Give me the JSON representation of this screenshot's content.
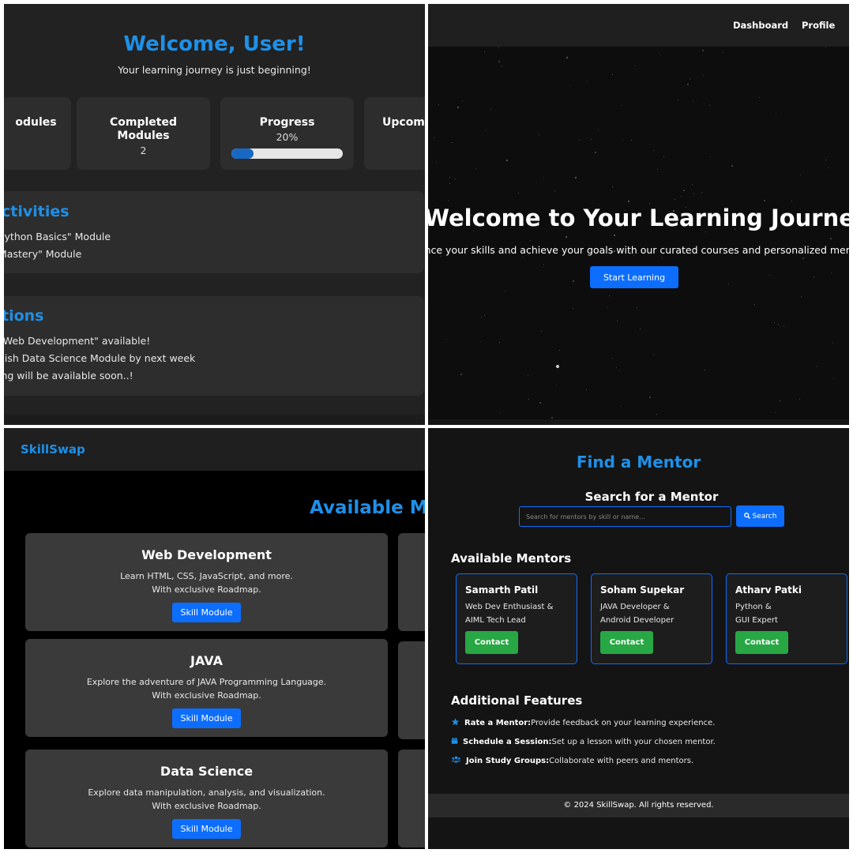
{
  "dashboard": {
    "title": "Welcome, User!",
    "subtitle": "Your learning journey is just beginning!",
    "stats": [
      {
        "label": "odules",
        "value": ""
      },
      {
        "label": "Completed Modules",
        "value": "2"
      },
      {
        "label": "Progress",
        "value": "20%",
        "progress_fraction": 0.2
      },
      {
        "label": "Upcomi",
        "value": ""
      }
    ],
    "activities": {
      "title": "ctivities",
      "items": [
        "Python Basics\" Module",
        " Mastery\" Module"
      ]
    },
    "notifications": {
      "title": "tions",
      "items": [
        "\"Web Development\" available!",
        "nish Data Science Module by next week",
        "ing will be available soon..!"
      ]
    }
  },
  "hero": {
    "nav": [
      "Dashboard",
      "Profile"
    ],
    "title": "Welcome to Your Learning Journey",
    "subtitle": "nhance your skills and achieve your goals with our curated courses and personalized mentors",
    "cta": "Start Learning"
  },
  "modules": {
    "brand": "SkillSwap",
    "title": "Available Mo",
    "button_label": "Skill Module",
    "cards": [
      {
        "title": "Web Development",
        "desc1": "Learn HTML, CSS, JavaScript, and more.",
        "desc2": "With exclusive Roadmap."
      },
      {
        "title": "JAVA",
        "desc1": "Explore the adventure of JAVA Programming Language.",
        "desc2": "With exclusive Roadmap."
      },
      {
        "title": "Data Science",
        "desc1": "Explore data manipulation, analysis, and visualization.",
        "desc2": "With exclusive Roadmap."
      }
    ]
  },
  "mentors": {
    "title": "Find a Mentor",
    "search_title": "Search for a Mentor",
    "search_placeholder": "Search for mentors by skill or name...",
    "search_button": "Search",
    "available_title": "Available Mentors",
    "contact_label": "Contact",
    "list": [
      {
        "name": "Samarth Patil",
        "role1": "Web Dev Enthusiast &",
        "role2": "AIML Tech Lead"
      },
      {
        "name": "Soham Supekar",
        "role1": "JAVA Developer &",
        "role2": "Android Developer"
      },
      {
        "name": "Atharv Patki",
        "role1": "Python &",
        "role2": "GUI Expert"
      }
    ],
    "features_title": "Additional Features",
    "features": [
      {
        "icon": "star-icon",
        "label": "Rate a Mentor:",
        "text": "Provide feedback on your learning experience."
      },
      {
        "icon": "calendar-icon",
        "label": "Schedule a Session:",
        "text": "Set up a lesson with your chosen mentor."
      },
      {
        "icon": "users-icon",
        "label": "Join Study Groups:",
        "text": "Collaborate with peers and mentors."
      }
    ],
    "footer": "© 2024 SkillSwap. All rights reserved."
  },
  "colors": {
    "accent_blue": "#1e90e8",
    "button_blue": "#0d6efd",
    "contact_green": "#28a745"
  }
}
